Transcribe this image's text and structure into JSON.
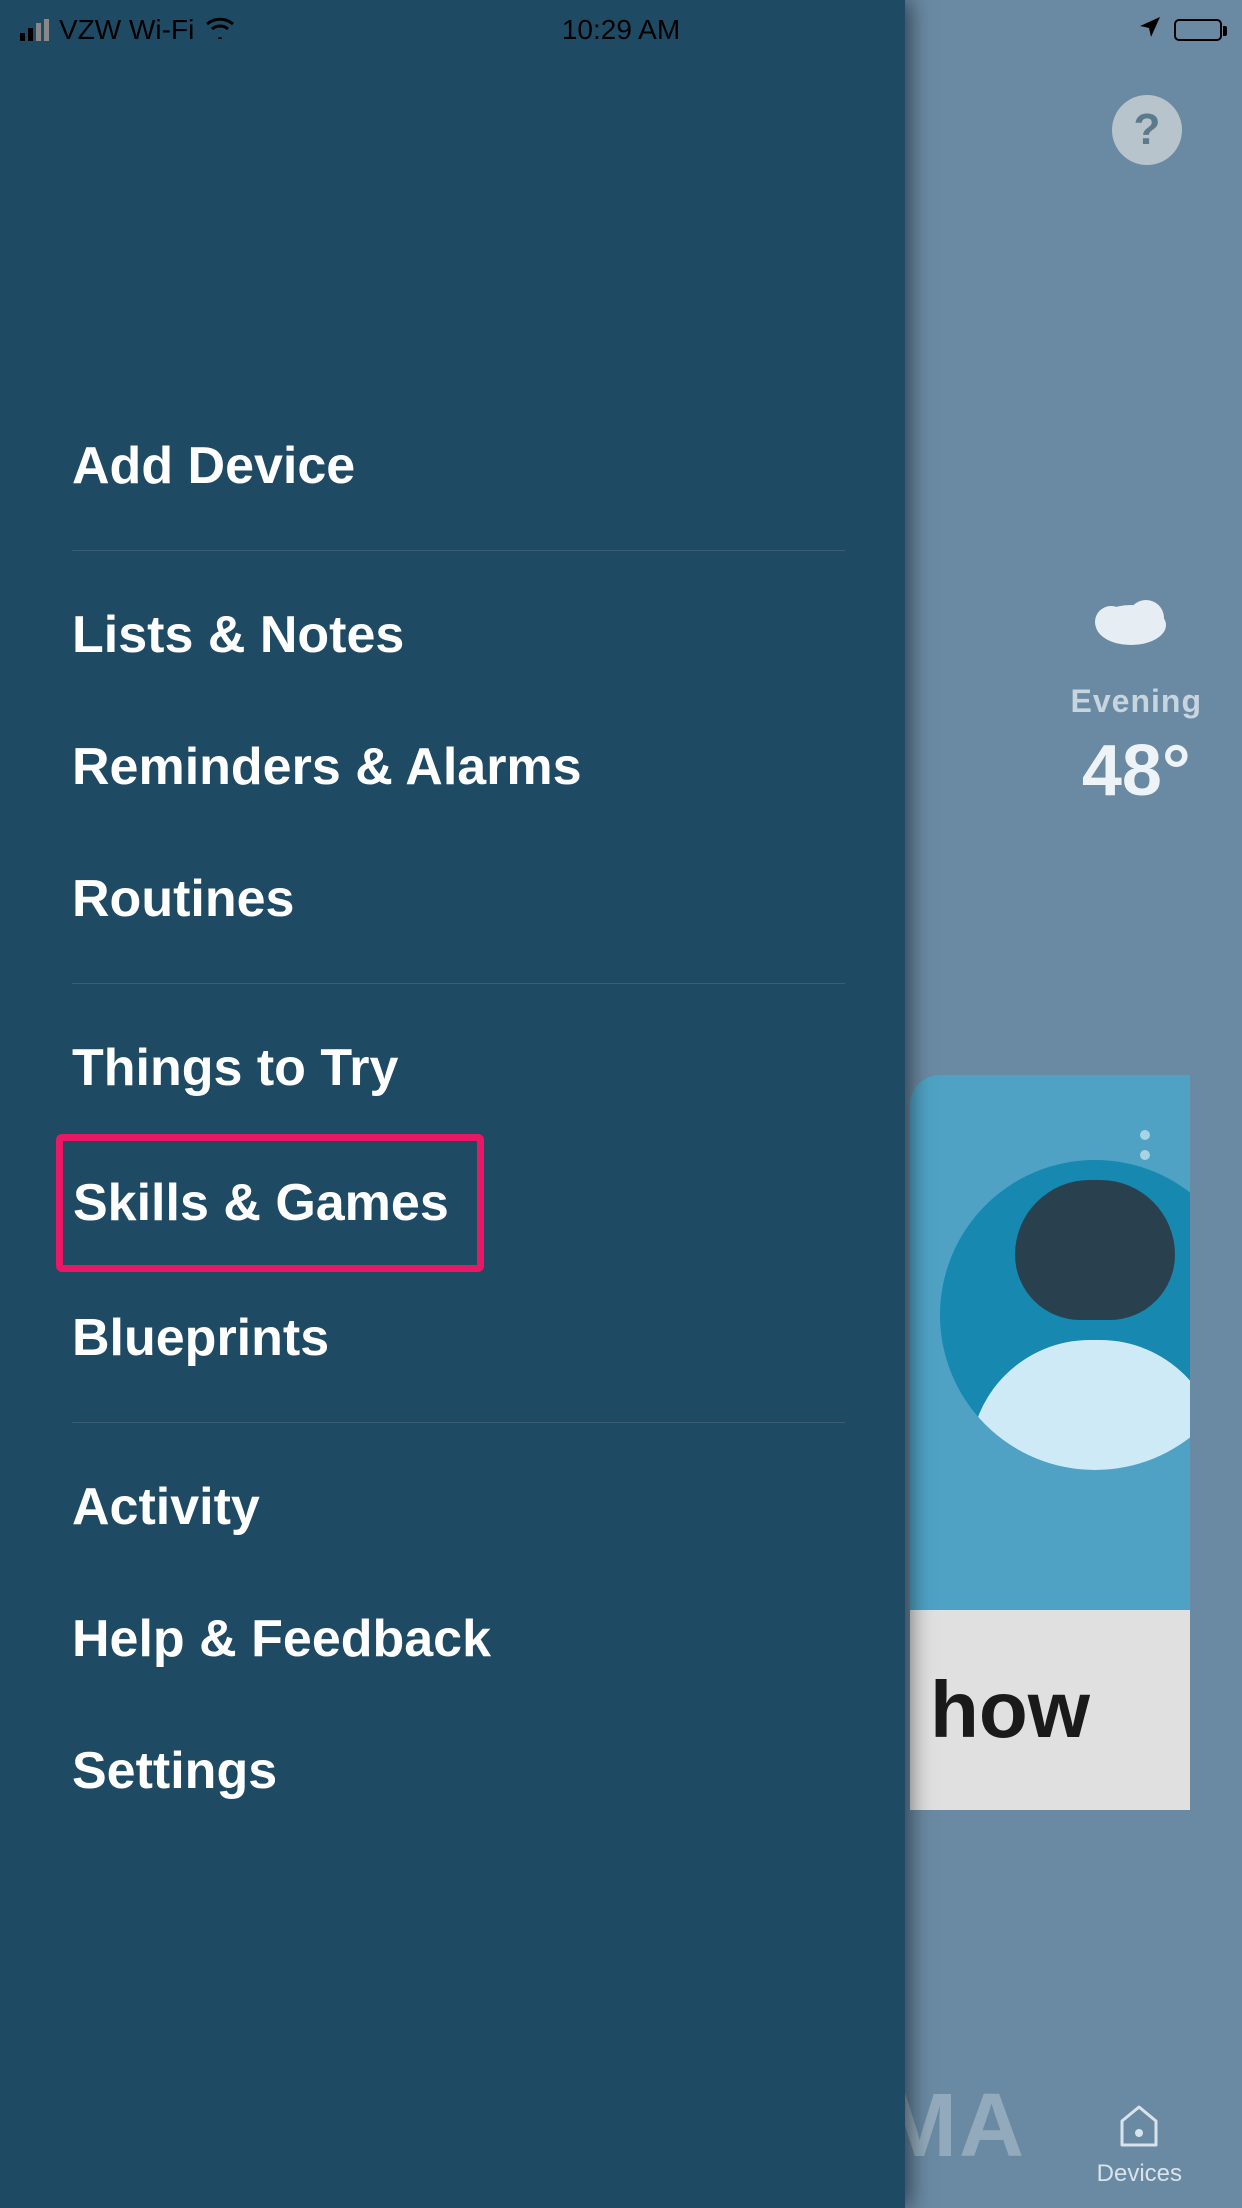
{
  "status_bar": {
    "carrier": "VZW Wi-Fi",
    "time": "10:29 AM"
  },
  "help_badge": "?",
  "weather": {
    "period_label": "Evening",
    "temperature": "48°"
  },
  "card": {
    "bottom_text": "how"
  },
  "bottom_nav": {
    "devices_label": "Devices"
  },
  "watermark": {
    "text": "SMA"
  },
  "menu": {
    "add_device": "Add Device",
    "lists_notes": "Lists & Notes",
    "reminders_alarms": "Reminders & Alarms",
    "routines": "Routines",
    "things_to_try": "Things to Try",
    "skills_games": "Skills & Games",
    "blueprints": "Blueprints",
    "activity": "Activity",
    "help_feedback": "Help & Feedback",
    "settings": "Settings"
  }
}
